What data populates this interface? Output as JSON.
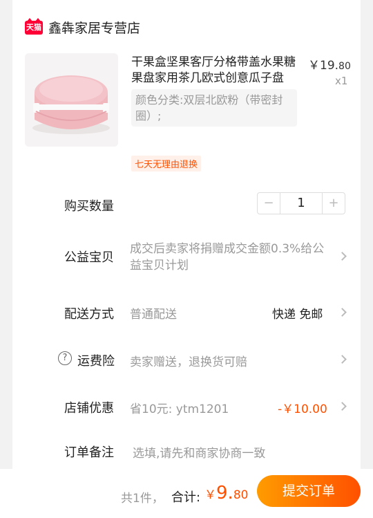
{
  "store": {
    "badge": "天猫",
    "name": "鑫犇家居专营店"
  },
  "product": {
    "title": "干果盒坚果客厅分格带盖水果糖果盘家用茶几欧式创意瓜子盘",
    "price_int": "￥19.",
    "price_dec": "80",
    "quantity_mark": "x1",
    "sku": "颜色分类:双层北欧粉（带密封圈）;",
    "return_tag": "七天无理由退换",
    "image_icon": "pink-round-snack-box"
  },
  "quantity": {
    "label": "购买数量",
    "minus": "−",
    "value": "1",
    "plus": "+"
  },
  "charity": {
    "label": "公益宝贝",
    "text": "成交后卖家将捐赠成交金额0.3%给公益宝贝计划"
  },
  "delivery": {
    "label": "配送方式",
    "value": "普通配送",
    "right": "快递 免邮"
  },
  "insurance": {
    "icon": "?",
    "label": "运费险",
    "value": "卖家赠送，退换货可赔"
  },
  "discount": {
    "label": "店铺优惠",
    "value": "省10元: ytm1201",
    "amount": "-￥10.00"
  },
  "remark": {
    "label": "订单备注",
    "placeholder": "选填,请先和商家协商一致"
  },
  "footer": {
    "count": "共1件，",
    "total_label": "合计:",
    "currency": "￥",
    "total_int": "9.",
    "total_dec": "80",
    "submit": "提交订单"
  },
  "colors": {
    "accent": "#ff5000",
    "tmall": "#ff0036",
    "submit_start": "#ff9c00"
  }
}
